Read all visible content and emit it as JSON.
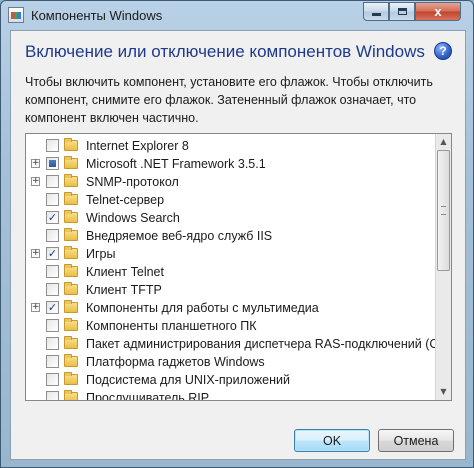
{
  "window": {
    "title": "Компоненты Windows"
  },
  "title_buttons": {
    "close_glyph": "x"
  },
  "main": {
    "heading": "Включение или отключение компонентов Windows",
    "help_glyph": "?",
    "description": "Чтобы включить компонент, установите его флажок. Чтобы отключить компонент, снимите его флажок. Затененный флажок означает, что компонент включен частично."
  },
  "features": [
    {
      "label": "Internet Explorer 8",
      "state": "unchecked",
      "expandable": false
    },
    {
      "label": "Microsoft .NET Framework 3.5.1",
      "state": "partial",
      "expandable": true
    },
    {
      "label": "SNMP-протокол",
      "state": "unchecked",
      "expandable": true
    },
    {
      "label": "Telnet-сервер",
      "state": "unchecked",
      "expandable": false
    },
    {
      "label": "Windows Search",
      "state": "checked",
      "expandable": false
    },
    {
      "label": "Внедряемое веб-ядро служб IIS",
      "state": "unchecked",
      "expandable": false
    },
    {
      "label": "Игры",
      "state": "checked",
      "expandable": true
    },
    {
      "label": "Клиент Telnet",
      "state": "unchecked",
      "expandable": false
    },
    {
      "label": "Клиент TFTP",
      "state": "unchecked",
      "expandable": false
    },
    {
      "label": "Компоненты для работы с мультимедиа",
      "state": "checked",
      "expandable": true
    },
    {
      "label": "Компоненты планшетного ПК",
      "state": "unchecked",
      "expandable": false
    },
    {
      "label": "Пакет администрирования диспетчера RAS-подключений (CM",
      "state": "unchecked",
      "expandable": false
    },
    {
      "label": "Платформа гаджетов Windows",
      "state": "unchecked",
      "expandable": false
    },
    {
      "label": "Подсистема для UNIX-приложений",
      "state": "unchecked",
      "expandable": false
    },
    {
      "label": "Прослушиватель RIP",
      "state": "unchecked",
      "expandable": false
    }
  ],
  "glyphs": {
    "check": "✓",
    "expand": "+",
    "scroll_up": "▲",
    "scroll_down": "▼"
  },
  "buttons": {
    "ok": "OK",
    "cancel": "Отмена"
  },
  "colors": {
    "heading": "#1e3a8a",
    "window_frame": "#a5c0d8"
  }
}
